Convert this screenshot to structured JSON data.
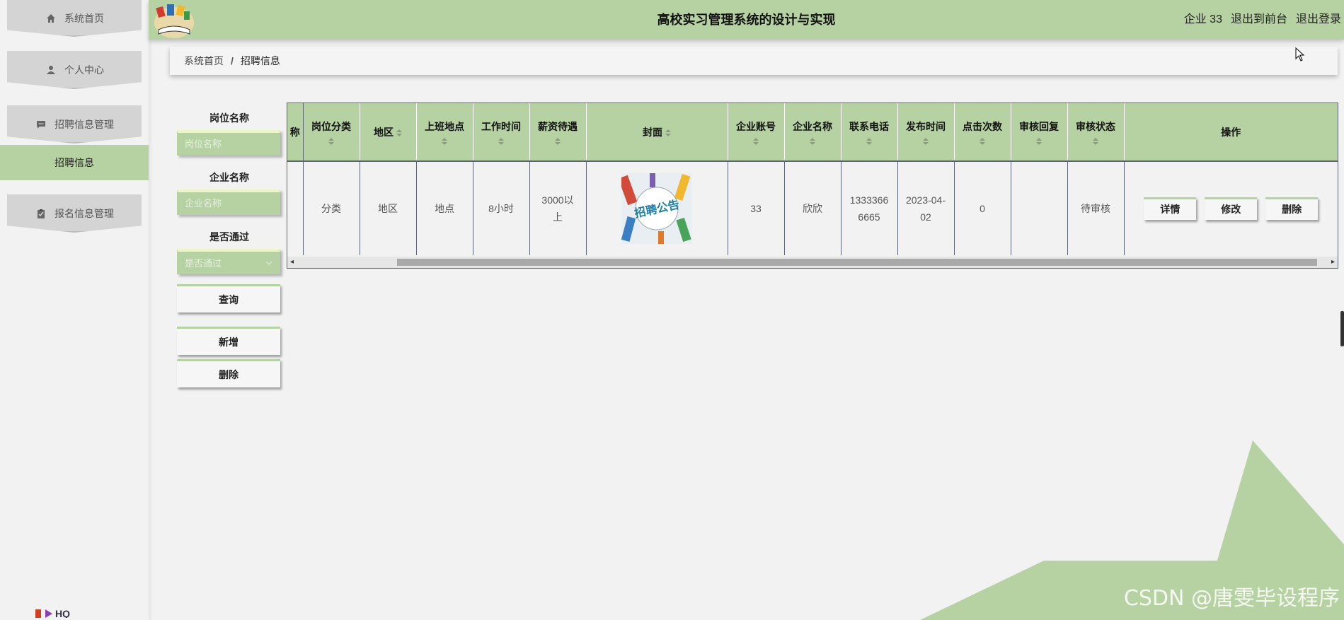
{
  "header": {
    "title": "高校实习管理系统的设计与实现",
    "user": "企业 33",
    "to_front": "退出到前台",
    "logout": "退出登录"
  },
  "sidebar": {
    "items": [
      {
        "label": "系统首页",
        "icon": "home-icon"
      },
      {
        "label": "个人中心",
        "icon": "user-icon"
      },
      {
        "label": "招聘信息管理",
        "icon": "chat-icon"
      },
      {
        "label": "报名信息管理",
        "icon": "clipboard-icon"
      }
    ],
    "active_sub": "招聘信息"
  },
  "breadcrumb": {
    "home": "系统首页",
    "separator": "/",
    "current": "招聘信息"
  },
  "search": {
    "job_label": "岗位名称",
    "job_placeholder": "岗位名称",
    "company_label": "企业名称",
    "company_placeholder": "企业名称",
    "pass_label": "是否通过",
    "pass_placeholder": "是否通过",
    "query": "查询",
    "add": "新增",
    "delete": "删除"
  },
  "table": {
    "columns": [
      "称",
      "岗位分类",
      "地区",
      "上班地点",
      "工作时间",
      "薪资待遇",
      "封面",
      "企业账号",
      "企业名称",
      "联系电话",
      "发布时间",
      "点击次数",
      "审核回复",
      "审核状态",
      "操作"
    ],
    "row": {
      "category": "分类",
      "region": "地区",
      "location": "地点",
      "hours": "8小时",
      "salary": "3000以上",
      "cover_text": "招聘公告",
      "account": "33",
      "company": "欣欣",
      "phone": "13333666665",
      "date": "2023-04-02",
      "clicks": "0",
      "reply": "",
      "status": "待审核"
    },
    "actions": {
      "detail": "详情",
      "edit": "修改",
      "delete": "删除"
    }
  },
  "watermark": "CSDN @唐雯毕设程序",
  "colors": {
    "accent": "#b6d2a2",
    "background": "#f2f2f2"
  }
}
